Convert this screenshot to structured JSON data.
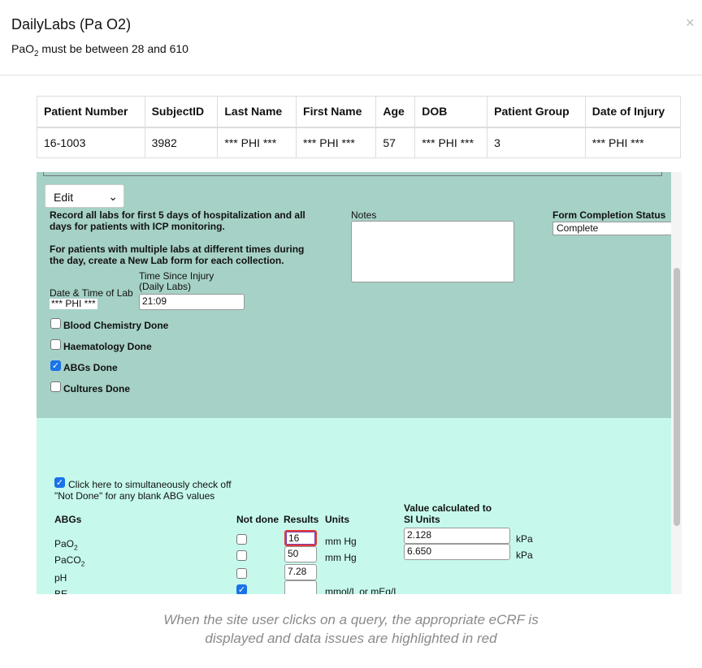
{
  "modal": {
    "title": "DailyLabs (Pa O2)",
    "close": "×",
    "subtitle_pre": "PaO",
    "subtitle_sub": "2",
    "subtitle_post": " must be between 28 and 610"
  },
  "patient_table": {
    "headers": [
      "Patient Number",
      "SubjectID",
      "Last Name",
      "First Name",
      "Age",
      "DOB",
      "Patient Group",
      "Date of Injury"
    ],
    "row": [
      "16-1003",
      "3982",
      "*** PHI ***",
      "*** PHI ***",
      "57",
      "*** PHI ***",
      "3",
      "*** PHI ***"
    ]
  },
  "form": {
    "edit_select": "Edit",
    "instr1a": "Record all labs for first 5 days of hospitalization and all",
    "instr1b": "days for patients with ICP monitoring.",
    "instr2a": "For patients with multiple labs at different times during",
    "instr2b": "the day, create a New Lab form for each collection.",
    "notes_label": "Notes",
    "notes_value": "",
    "status_label": "Form Completion Status",
    "status_value": "Complete",
    "date_label": "Date & Time of Lab",
    "date_value": "*** PHI ***",
    "tsi_label1": "Time Since Injury",
    "tsi_label2": "(Daily Labs)",
    "tsi_value": "21:09",
    "checks": [
      {
        "label": "Blood Chemistry Done",
        "checked": false
      },
      {
        "label": "Haematology Done",
        "checked": false
      },
      {
        "label": "ABGs Done",
        "checked": true
      },
      {
        "label": "Cultures Done",
        "checked": false
      }
    ],
    "notdone_all1": "Click here to simultaneously check off",
    "notdone_all2": "\"Not Done\" for any blank ABG values",
    "notdone_all_checked": true,
    "abg_headers": {
      "name": "ABGs",
      "notdone": "Not done",
      "results": "Results",
      "units": "Units",
      "si1": "Value calculated to",
      "si2": "SI Units"
    },
    "abgs": [
      {
        "name": "PaO",
        "sub": "2",
        "notdone": false,
        "result": "16",
        "units": "mm Hg",
        "si": "2.128",
        "si_units": "kPa",
        "error": true
      },
      {
        "name": "PaCO",
        "sub": "2",
        "notdone": false,
        "result": "50",
        "units": "mm Hg",
        "si": "6.650",
        "si_units": "kPa"
      },
      {
        "name": "pH",
        "sub": "",
        "notdone": false,
        "result": "7.28",
        "units": ""
      },
      {
        "name": "BE",
        "sub": "",
        "notdone": true,
        "result": "",
        "units": "mmol/L or mEq/L"
      }
    ],
    "error_color": "#e53935"
  },
  "caption1": "When the site user clicks on a query, the appropriate eCRF is",
  "caption2": "displayed and data issues are highlighted in red"
}
